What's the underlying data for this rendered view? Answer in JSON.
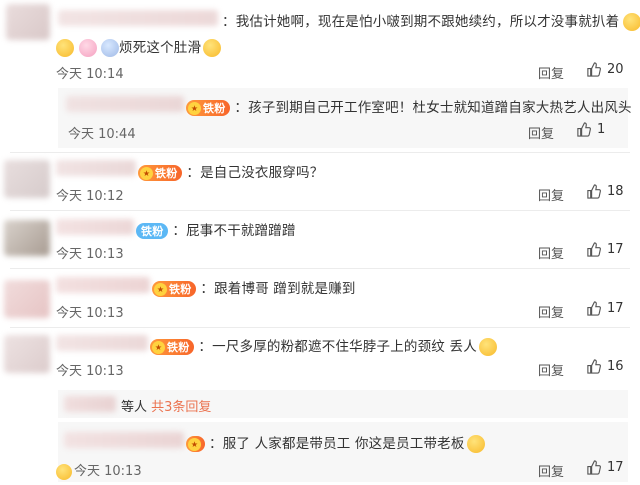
{
  "comments": [
    {
      "text": "：我估计她啊，现在是怕小啵到期不跟她续约，所以才没事就扒着",
      "text2": "烦死这个肚滑",
      "time": "今天 10:14",
      "reply": "回复",
      "likes": "20"
    },
    {
      "badge": "铁粉",
      "text": "：孩子到期自己开工作室吧！杜女士就知道蹭自家大热艺人出风头",
      "time": "今天 10:44",
      "reply": "回复",
      "likes": "1"
    },
    {
      "badge": "铁粉",
      "text": "：是自己没衣服穿吗？",
      "time": "今天 10:12",
      "reply": "回复",
      "likes": "18"
    },
    {
      "badge": "铁粉",
      "text": "：屁事不干就蹭蹭蹭",
      "time": "今天 10:13",
      "reply": "回复",
      "likes": "17"
    },
    {
      "badge": "铁粉",
      "text": "：跟着博哥 蹭到就是赚到",
      "time": "今天 10:13",
      "reply": "回复",
      "likes": "17"
    },
    {
      "badge": "铁粉",
      "text": "：一尺多厚的粉都遮不住华脖子上的颈纹 丢人",
      "time": "今天 10:13",
      "reply": "回复",
      "likes": "16"
    },
    {
      "text": "：服了 人家都是带员工 你这是员工带老板",
      "time": "今天 10:13",
      "reply": "回复",
      "likes": "17"
    }
  ],
  "expand": {
    "who": "等人",
    "more": "共3条回复"
  }
}
